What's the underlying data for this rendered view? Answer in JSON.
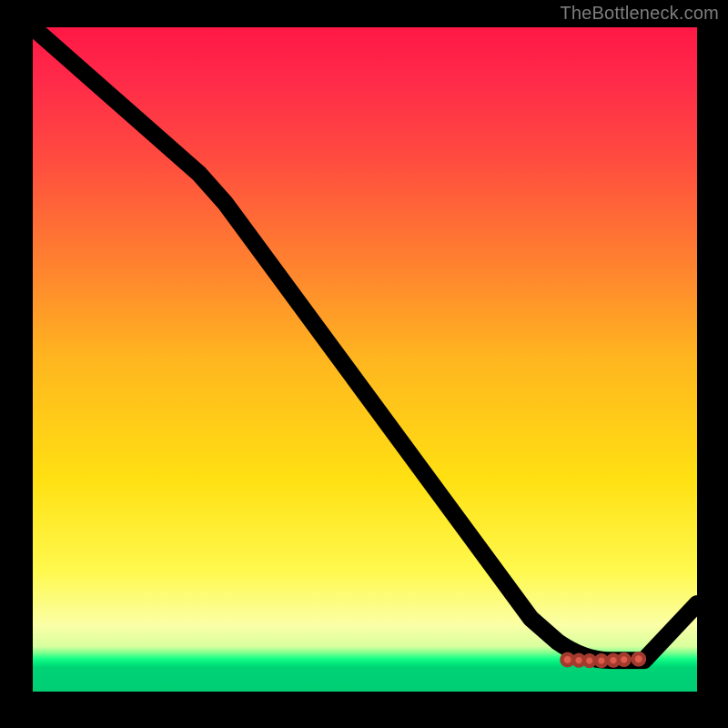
{
  "watermark": "TheBottleneck.com",
  "chart_data": {
    "type": "line",
    "title": "",
    "xlabel": "",
    "ylabel": "",
    "xlim": [
      0,
      100
    ],
    "ylim": [
      0,
      100
    ],
    "note": "Axes are unlabeled in the image; values are normalized to the plot box (0 = left/top edge of gradient, 100 = right/bottom). The curve descends from top-left, has a flat minimum around x≈80–92 at y≈95, then rises toward x=100. A cluster of small reddish markers sits on the flat minimum.",
    "series": [
      {
        "name": "curve",
        "x": [
          0,
          25,
          29,
          75,
          79,
          83,
          87,
          92,
          100
        ],
        "y": [
          0,
          22,
          26.5,
          89,
          92.5,
          95.3,
          95.3,
          95.3,
          86.8
        ]
      }
    ],
    "markers": {
      "name": "highlighted-range",
      "x": [
        80.5,
        82.2,
        83.8,
        85.6,
        87.4,
        89.0,
        91.2
      ],
      "y": [
        95.2,
        95.3,
        95.35,
        95.35,
        95.3,
        95.2,
        95.1
      ],
      "color": "#de5a4a"
    },
    "background_gradient_stops": [
      {
        "pos": 0.0,
        "color": "#ff1846"
      },
      {
        "pos": 0.38,
        "color": "#ff8a2d"
      },
      {
        "pos": 0.68,
        "color": "#ffe012"
      },
      {
        "pos": 0.9,
        "color": "#fbffa6"
      },
      {
        "pos": 0.95,
        "color": "#1aff88"
      },
      {
        "pos": 1.0,
        "color": "#00ce74"
      }
    ]
  }
}
